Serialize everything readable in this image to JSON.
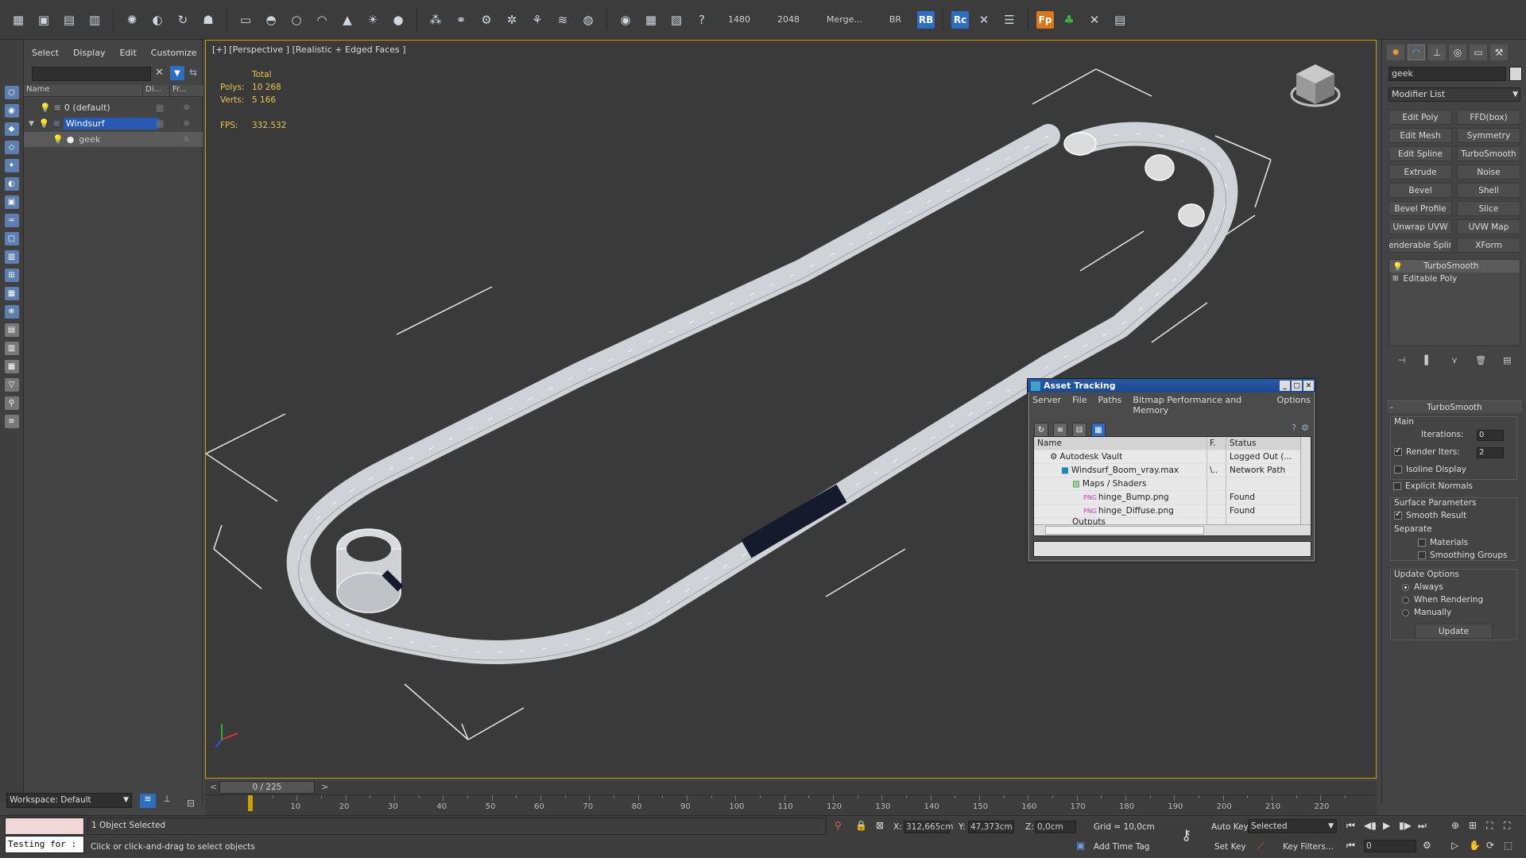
{
  "toolbar": {
    "res_width": "1480",
    "res_height": "2048",
    "merge_label": "Merge...",
    "br_label": "BR",
    "rb_label": "RB",
    "rc_label": "Rc",
    "fp_label": "Fp"
  },
  "explorer": {
    "menu": [
      "Select",
      "Display",
      "Edit",
      "Customize"
    ],
    "columns": [
      "Name",
      "Di...",
      "Fr..."
    ],
    "rows": [
      {
        "label": "0 (default)",
        "selected": false
      },
      {
        "label": "Windsurf",
        "selected": true
      },
      {
        "label": "geek",
        "selected": false
      }
    ]
  },
  "viewport": {
    "label": "[+] [Perspective ] [Realistic + Edged Faces ]",
    "stats_header": "Total",
    "polys_label": "Polys:",
    "polys_value": "10 268",
    "verts_label": "Verts:",
    "verts_value": "5 166",
    "fps_label": "FPS:",
    "fps_value": "332.532"
  },
  "asset_tracking": {
    "title": "Asset Tracking",
    "menu": [
      "Server",
      "File",
      "Paths",
      "Bitmap Performance and Memory",
      "Options"
    ],
    "headers": [
      "Name",
      "F.",
      "Status"
    ],
    "rows": [
      {
        "name": "Autodesk Vault",
        "f": "",
        "status": "Logged Out (..."
      },
      {
        "name": "Windsurf_Boom_vray.max",
        "f": "\\..",
        "status": "Network Path"
      },
      {
        "name": "Maps / Shaders",
        "f": "",
        "status": ""
      },
      {
        "name": "hinge_Bump.png",
        "f": "",
        "status": "Found"
      },
      {
        "name": "hinge_Diffuse.png",
        "f": "",
        "status": "Found"
      },
      {
        "name": "Outputs",
        "f": "",
        "status": ""
      }
    ]
  },
  "command_panel": {
    "object_name": "geek",
    "modifier_list": "Modifier List",
    "modifier_buttons": [
      "Edit Poly",
      "FFD(box)",
      "Edit Mesh",
      "Symmetry",
      "Edit Spline",
      "TurboSmooth",
      "Extrude",
      "Noise",
      "Bevel",
      "Shell",
      "Bevel Profile",
      "Slice",
      "Unwrap UVW",
      "UVW Map",
      "enderable Splir",
      "XForm"
    ],
    "stack": [
      "TurboSmooth",
      "Editable Poly"
    ],
    "rollout_title": "TurboSmooth",
    "main_label": "Main",
    "iterations_label": "Iterations:",
    "iterations_value": "0",
    "render_iters_label": "Render Iters:",
    "render_iters_value": "2",
    "isoline_label": "Isoline Display",
    "explicit_normals_label": "Explicit Normals",
    "surface_params_label": "Surface Parameters",
    "smooth_result_label": "Smooth Result",
    "separate_label": "Separate",
    "materials_label": "Materials",
    "smoothing_groups_label": "Smoothing Groups",
    "update_options_label": "Update Options",
    "always_label": "Always",
    "when_rendering_label": "When Rendering",
    "manually_label": "Manually",
    "update_button": "Update"
  },
  "timeline": {
    "frame_display": "0 / 225",
    "ticks": [
      "10",
      "20",
      "30",
      "40",
      "50",
      "60",
      "70",
      "80",
      "90",
      "100",
      "110",
      "120",
      "130",
      "140",
      "150",
      "160",
      "170",
      "180",
      "190",
      "200",
      "210",
      "220"
    ]
  },
  "status_bar": {
    "workspace": "Workspace: Default",
    "maxscript_text": "Testing for :",
    "selection_status": "1 Object Selected",
    "prompt": "Click or click-and-drag to select objects",
    "x_label": "X:",
    "x_value": "312,665cm",
    "y_label": "Y:",
    "y_value": "47,373cm",
    "z_label": "Z:",
    "z_value": "0,0cm",
    "grid": "Grid = 10,0cm",
    "add_time_tag": "Add Time Tag",
    "auto_key": "Auto Key",
    "set_key": "Set Key",
    "selected_dropdown": "Selected",
    "key_filters": "Key Filters...",
    "current_frame": "0"
  }
}
